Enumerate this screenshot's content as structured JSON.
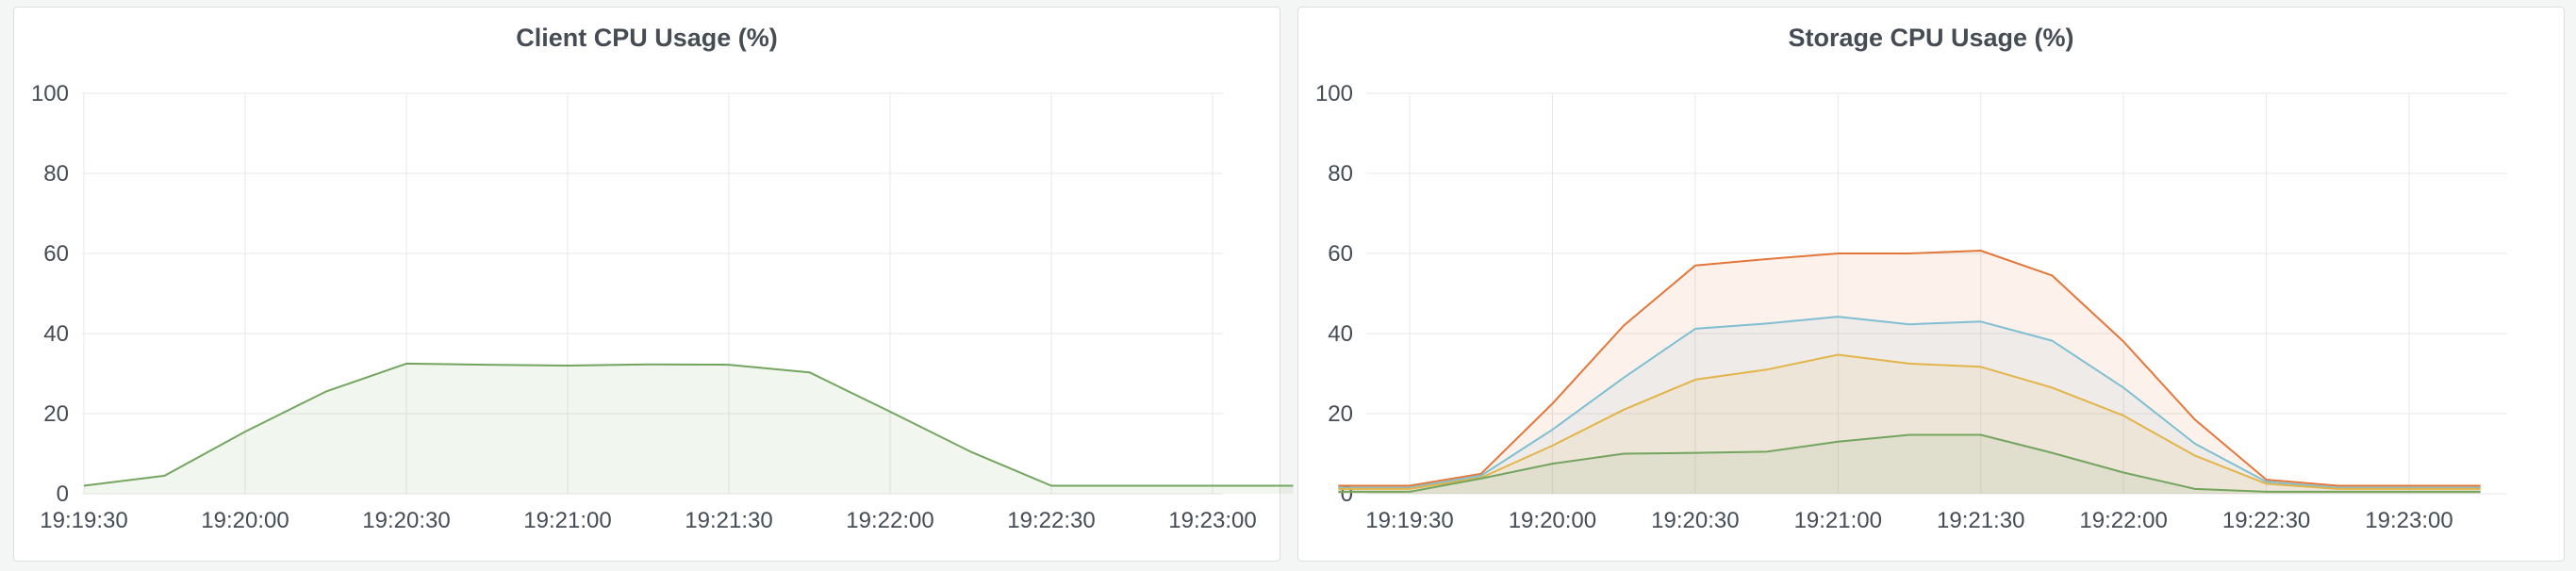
{
  "chart_data": [
    {
      "type": "area",
      "title": "Client CPU Usage (%)",
      "xlabel": "",
      "ylabel": "",
      "ylim": [
        0,
        100
      ],
      "yticks": [
        "0",
        "20",
        "40",
        "60",
        "80",
        "100"
      ],
      "xticks": [
        "19:19:30",
        "19:20:00",
        "19:20:30",
        "19:21:00",
        "19:21:30",
        "19:22:00",
        "19:22:30",
        "19:23:00"
      ],
      "grid": true,
      "x": [
        "19:19:30",
        "19:19:45",
        "19:20:00",
        "19:20:15",
        "19:20:30",
        "19:20:45",
        "19:21:00",
        "19:21:15",
        "19:21:30",
        "19:21:45",
        "19:22:00",
        "19:22:15",
        "19:22:30",
        "19:22:45",
        "19:23:00",
        "19:23:15"
      ],
      "series": [
        {
          "color": "#73a55f",
          "values": [
            2,
            4.5,
            15.5,
            25.5,
            32.5,
            32.2,
            32,
            32.3,
            32.2,
            30.3,
            20.5,
            10.5,
            2,
            2,
            2,
            2
          ]
        }
      ]
    },
    {
      "type": "area",
      "title": "Storage CPU Usage (%)",
      "xlabel": "",
      "ylabel": "",
      "ylim": [
        0,
        100
      ],
      "yticks": [
        "0",
        "20",
        "40",
        "60",
        "80",
        "100"
      ],
      "xticks": [
        "19:19:30",
        "19:20:00",
        "19:20:30",
        "19:21:00",
        "19:21:30",
        "19:22:00",
        "19:22:30",
        "19:23:00"
      ],
      "grid": true,
      "x": [
        "19:19:15",
        "19:19:30",
        "19:19:45",
        "19:20:00",
        "19:20:15",
        "19:20:30",
        "19:20:45",
        "19:21:00",
        "19:21:15",
        "19:21:30",
        "19:21:45",
        "19:22:00",
        "19:22:15",
        "19:22:30",
        "19:22:45",
        "19:23:00",
        "19:23:15"
      ],
      "series": [
        {
          "color": "#e3773a",
          "values": [
            2,
            2,
            5,
            22.5,
            42,
            57,
            58.6,
            60,
            60,
            60.7,
            54.5,
            38,
            18.5,
            3.5,
            2,
            2,
            2
          ]
        },
        {
          "color": "#7fbfd2",
          "values": [
            1.5,
            1.5,
            4.5,
            16,
            29,
            41.2,
            42.5,
            44.2,
            42.3,
            43,
            38.2,
            26.5,
            12.5,
            3,
            1.5,
            1.5,
            1.5
          ]
        },
        {
          "color": "#e2b44a",
          "values": [
            1.2,
            1.2,
            4,
            12,
            21,
            28.5,
            31,
            34.7,
            32.5,
            31.7,
            26.5,
            19.5,
            9.5,
            2.5,
            1.2,
            1.2,
            1.2
          ]
        },
        {
          "color": "#73a55f",
          "values": [
            0.5,
            0.5,
            3.8,
            7.5,
            10,
            10.2,
            10.5,
            13,
            14.7,
            14.7,
            10.2,
            5.3,
            1.2,
            0.5,
            0.5,
            0.5,
            0.5
          ]
        }
      ]
    }
  ]
}
